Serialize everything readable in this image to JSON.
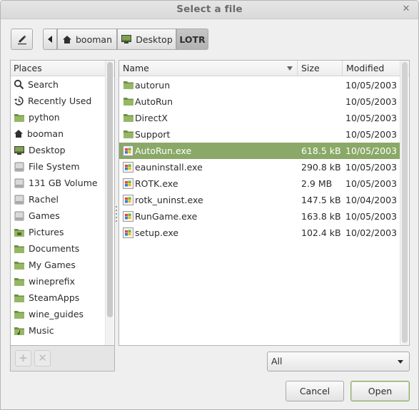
{
  "window": {
    "title": "Select a file"
  },
  "pathbar": {
    "crumbs": [
      {
        "label": "booman",
        "icon": "home-icon"
      },
      {
        "label": "Desktop",
        "icon": "desktop-icon"
      },
      {
        "label": "LOTR",
        "icon": "",
        "active": true
      }
    ]
  },
  "places": {
    "header": "Places",
    "items": [
      {
        "label": "Search",
        "icon": "search-icon"
      },
      {
        "label": "Recently Used",
        "icon": "recent-icon"
      },
      {
        "label": "python",
        "icon": "folder-icon"
      },
      {
        "label": "booman",
        "icon": "home-icon"
      },
      {
        "label": "Desktop",
        "icon": "desktop-icon"
      },
      {
        "label": "File System",
        "icon": "drive-icon"
      },
      {
        "label": "131 GB Volume",
        "icon": "drive-icon"
      },
      {
        "label": "Rachel",
        "icon": "drive-icon"
      },
      {
        "label": "Games",
        "icon": "drive-icon"
      },
      {
        "label": "Pictures",
        "icon": "pictures-folder-icon"
      },
      {
        "label": "Documents",
        "icon": "folder-icon"
      },
      {
        "label": "My Games",
        "icon": "folder-icon"
      },
      {
        "label": "wineprefix",
        "icon": "folder-icon"
      },
      {
        "label": "SteamApps",
        "icon": "folder-icon"
      },
      {
        "label": "wine_guides",
        "icon": "folder-icon"
      },
      {
        "label": "Music",
        "icon": "music-folder-icon"
      }
    ]
  },
  "files": {
    "columns": {
      "name": "Name",
      "size": "Size",
      "modified": "Modified"
    },
    "rows": [
      {
        "name": "autorun",
        "size": "",
        "modified": "10/05/2003",
        "type": "folder"
      },
      {
        "name": "AutoRun",
        "size": "",
        "modified": "10/05/2003",
        "type": "folder"
      },
      {
        "name": "DirectX",
        "size": "",
        "modified": "10/05/2003",
        "type": "folder"
      },
      {
        "name": "Support",
        "size": "",
        "modified": "10/05/2003",
        "type": "folder"
      },
      {
        "name": "AutoRun.exe",
        "size": "618.5 kB",
        "modified": "10/05/2003",
        "type": "exe",
        "selected": true
      },
      {
        "name": "eauninstall.exe",
        "size": "290.8 kB",
        "modified": "10/05/2003",
        "type": "exe"
      },
      {
        "name": "ROTK.exe",
        "size": "2.9 MB",
        "modified": "10/05/2003",
        "type": "exe"
      },
      {
        "name": "rotk_uninst.exe",
        "size": "147.5 kB",
        "modified": "10/04/2003",
        "type": "exe"
      },
      {
        "name": "RunGame.exe",
        "size": "163.8 kB",
        "modified": "10/05/2003",
        "type": "exe"
      },
      {
        "name": "setup.exe",
        "size": "102.4 kB",
        "modified": "10/02/2003",
        "type": "exe"
      }
    ]
  },
  "filter": {
    "selected": "All"
  },
  "buttons": {
    "cancel": "Cancel",
    "open": "Open"
  },
  "colors": {
    "selection": "#8aa867",
    "folder": "#8cae5a"
  }
}
